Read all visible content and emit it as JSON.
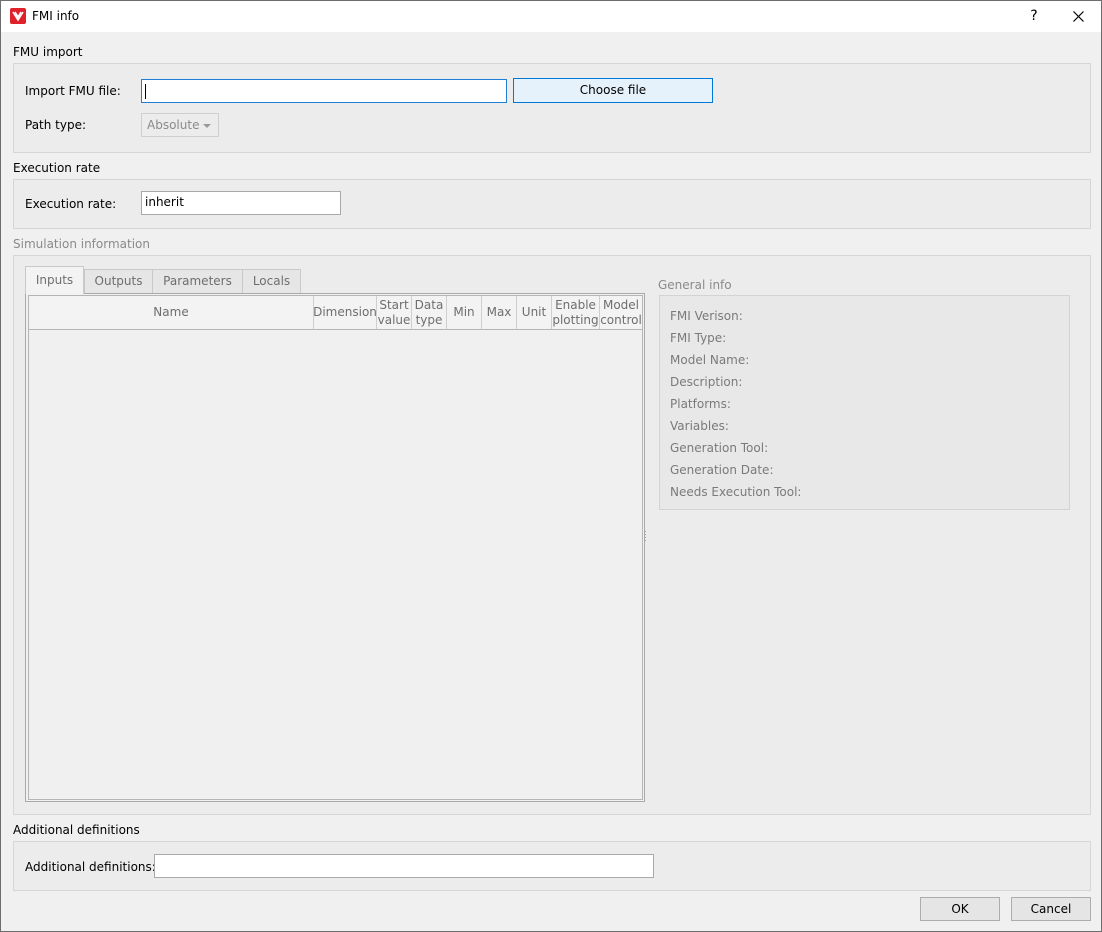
{
  "window": {
    "title": "FMI info",
    "help": "?",
    "close": "✕"
  },
  "fmu_import": {
    "section": "FMU import",
    "file_label": "Import FMU file:",
    "file_value": "",
    "choose_label": "Choose file",
    "path_label": "Path type:",
    "path_value": "Absolute"
  },
  "execution": {
    "section": "Execution rate",
    "label": "Execution rate:",
    "value": "inherit"
  },
  "simulation": {
    "section": "Simulation information",
    "tabs": [
      "Inputs",
      "Outputs",
      "Parameters",
      "Locals"
    ],
    "columns": [
      {
        "line1": "Name",
        "line2": ""
      },
      {
        "line1": "Dimension",
        "line2": ""
      },
      {
        "line1": "Start",
        "line2": "value"
      },
      {
        "line1": "Data",
        "line2": "type"
      },
      {
        "line1": "Min",
        "line2": ""
      },
      {
        "line1": "Max",
        "line2": ""
      },
      {
        "line1": "Unit",
        "line2": ""
      },
      {
        "line1": "Enable",
        "line2": "plotting"
      },
      {
        "line1": "Model",
        "line2": "control"
      }
    ]
  },
  "general_info": {
    "title": "General info",
    "rows": [
      "FMI Verison:",
      "FMI Type:",
      "Model Name:",
      "Description:",
      "Platforms:",
      "Variables:",
      "Generation Tool:",
      "Generation Date:",
      "Needs Execution Tool:"
    ]
  },
  "additional": {
    "section": "Additional definitions",
    "label": "Additional definitions:",
    "value": ""
  },
  "footer": {
    "ok": "OK",
    "cancel": "Cancel"
  },
  "colors": {
    "accent": "#0078d7",
    "focus": "#1e7fd6",
    "app_icon": "#e0202a"
  }
}
